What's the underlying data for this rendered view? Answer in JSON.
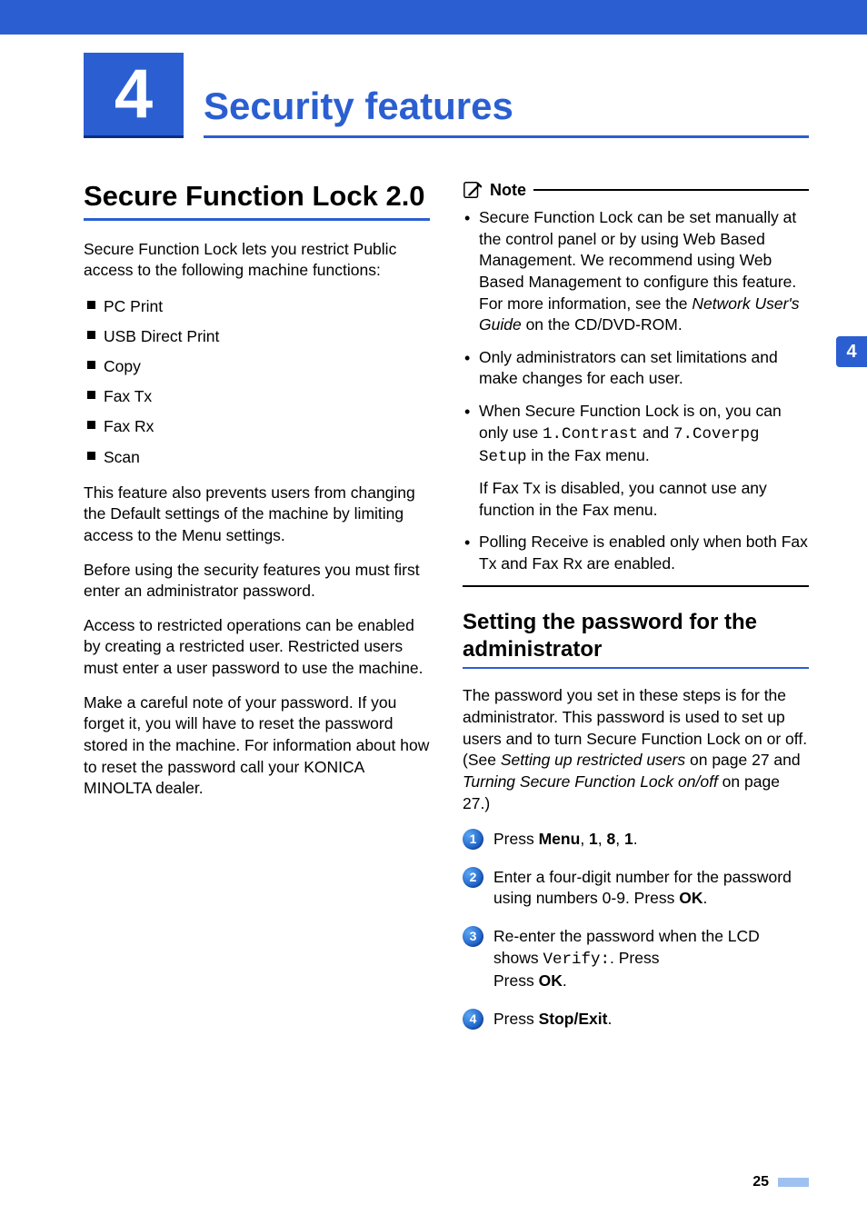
{
  "chapter": {
    "number": "4",
    "title": "Security features"
  },
  "side_tab": "4",
  "page_number": "25",
  "left": {
    "h1": "Secure Function Lock 2.0",
    "p1": "Secure Function Lock lets you restrict Public access to the following machine functions:",
    "features": [
      "PC Print",
      "USB Direct Print",
      "Copy",
      "Fax Tx",
      "Fax Rx",
      "Scan"
    ],
    "p2": "This feature also prevents users from changing the Default settings of the machine by limiting access to the Menu settings.",
    "p3": "Before using the security features you must first enter an administrator password.",
    "p4": "Access to restricted operations can be enabled by creating a restricted user. Restricted users must enter a user password to use the machine.",
    "p5": "Make a careful note of your password. If you forget it, you will have to reset the password stored in the machine. For information about how to reset the password call your KONICA MINOLTA dealer."
  },
  "right": {
    "note_label": "Note",
    "note1": {
      "pre": "Secure Function Lock can be set manually at the control panel or by using Web Based Management. We recommend using Web Based Management to configure this feature. For more information, see the ",
      "em": "Network User's Guide",
      "post": " on the CD/DVD-ROM."
    },
    "note2": "Only administrators can set limitations and make changes for each user.",
    "note3": {
      "pre": "When Secure Function Lock is on, you can only use ",
      "code1": "1.Contrast",
      "mid": " and ",
      "code2": "7.Coverpg Setup",
      "post": " in the Fax menu.",
      "sub": "If Fax Tx is disabled, you cannot use any function in the Fax menu."
    },
    "note4": "Polling Receive is enabled only when both Fax Tx and Fax Rx are enabled.",
    "h2": "Setting the password for the administrator",
    "intro": {
      "pre": "The password you set in these steps is for the administrator. This password is used to set up users and to turn Secure Function Lock on or off. (See ",
      "em1": "Setting up restricted users",
      "mid1": " on page 27 and ",
      "em2": "Turning Secure Function Lock on/off",
      "post": " on page 27.)"
    },
    "steps": {
      "s1": {
        "pre": "Press ",
        "b": "Menu",
        "mid": ", ",
        "b1": "1",
        "c1": ", ",
        "b2": "8",
        "c2": ", ",
        "b3": "1",
        "end": "."
      },
      "s2": {
        "text": "Enter a four-digit number for the password using numbers 0-9. Press ",
        "b": "OK",
        "end": "."
      },
      "s3": {
        "pre": "Re-enter the password when the LCD shows ",
        "code": "Verify:",
        "mid": ". Press ",
        "b": "OK",
        "end": "."
      },
      "s4": {
        "pre": "Press ",
        "b": "Stop/Exit",
        "end": "."
      }
    }
  }
}
